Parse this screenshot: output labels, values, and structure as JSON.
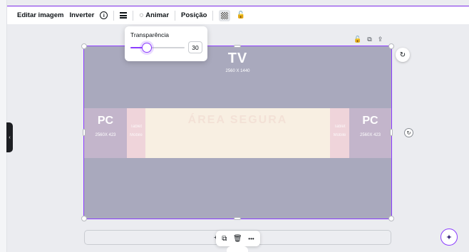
{
  "toolbar": {
    "edit_image": "Editar imagem",
    "flip": "Inverter",
    "info_icon": "i",
    "lines_icon": "lines-icon",
    "animate_icon": "◌",
    "animate": "Animar",
    "position": "Posição",
    "lock_icon": "🔓"
  },
  "transparency": {
    "label": "Transparência",
    "value": "30",
    "level_percent": 30
  },
  "canvas_icons": {
    "lock": "🔓",
    "copy": "⧉",
    "share": "⇪"
  },
  "design": {
    "tv_title": "TV",
    "tv_size": "2560 X 1440",
    "pc_left_title": "PC",
    "pc_left_size": "2560X 423",
    "pc_right_title": "PC",
    "pc_right_size": "2560X 423",
    "sb_left_top": "Tablet",
    "sb_left_bottom": "Mobile",
    "sb_right_top": "Tablet",
    "sb_right_bottom": "Mobile",
    "safe_area": "ÁREA SEGURA"
  },
  "rotate_icon": "↻",
  "small_rotate_icon": "↻",
  "notes": {
    "text": "+ a"
  },
  "mini_toolbar": {
    "copy": "⧉",
    "delete": "🗑",
    "more": "•••"
  },
  "magic_icon": "✦",
  "colors": {
    "accent": "#8b3dff",
    "canvas_bg": "#a9a9bd",
    "pc_panel": "#c3b5cb",
    "tablet_panel": "#efd4da",
    "safe_panel": "#f8efe2"
  }
}
